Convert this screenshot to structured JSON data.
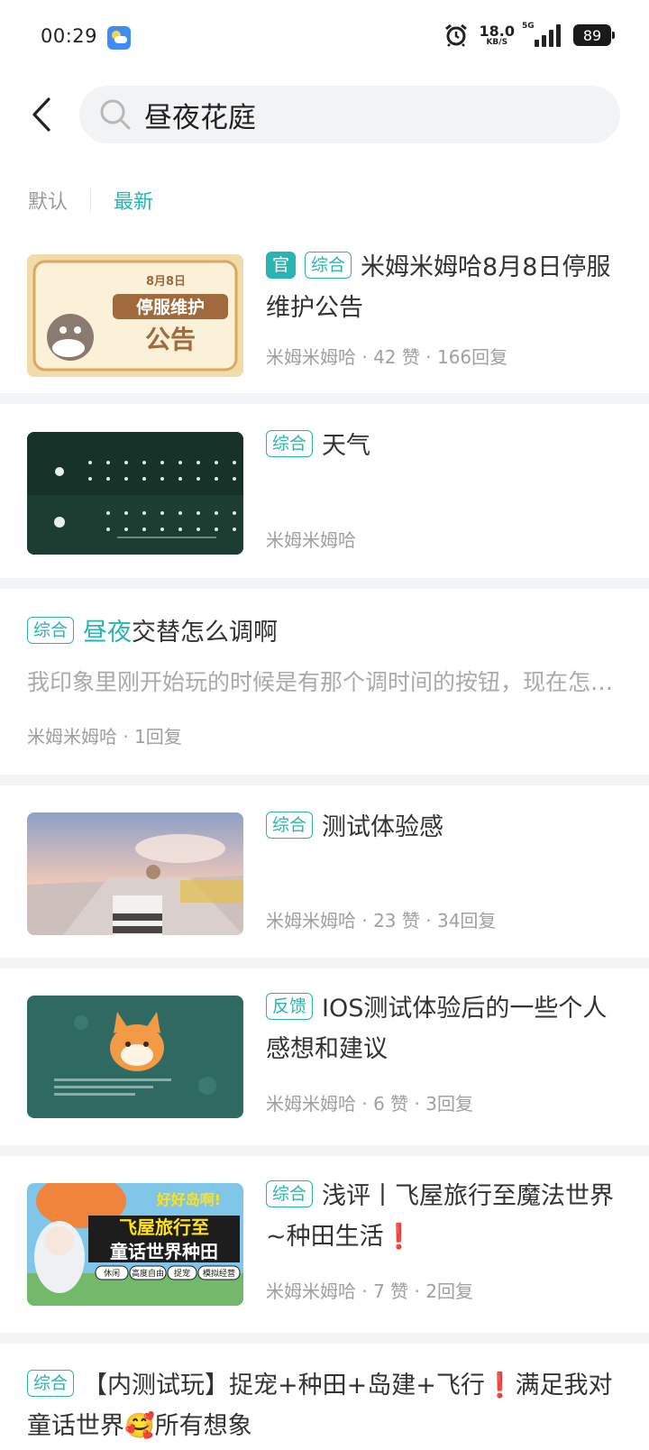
{
  "status_bar": {
    "time": "00:29",
    "net_speed": "18.0",
    "net_unit": "KB/S",
    "network_type": "5G",
    "battery": "89"
  },
  "search": {
    "query": "昼夜花庭"
  },
  "sort_tabs": {
    "default_label": "默认",
    "latest_label": "最新",
    "active": "latest"
  },
  "colors": {
    "accent": "#2ab3b3",
    "alert": "#e23b3b"
  },
  "posts": [
    {
      "tags": [
        "官",
        "综合"
      ],
      "title": "米姆米姆哈8月8日停服维护公告",
      "author": "米姆米姆哈",
      "likes": "42 赞",
      "replies": "166回复",
      "thumb_text_1": "8月8日",
      "thumb_text_2": "停服维护",
      "thumb_text_3": "公告"
    },
    {
      "tags": [
        "综合"
      ],
      "title": "天气",
      "author": "米姆米姆哈"
    },
    {
      "tags": [
        "综合"
      ],
      "title_highlight": "昼夜",
      "title_rest": "交替怎么调啊",
      "excerpt": "我印象里刚开始玩的时候是有那个调时间的按钮，现在怎么找不到了呢",
      "author": "米姆米姆哈",
      "replies": "1回复"
    },
    {
      "tags": [
        "综合"
      ],
      "title": "测试体验感",
      "author": "米姆米姆哈",
      "likes": "23 赞",
      "replies": "34回复"
    },
    {
      "tags": [
        "反馈"
      ],
      "title": "IOS测试体验后的一些个人感想和建议",
      "author": "米姆米姆哈",
      "likes": "6 赞",
      "replies": "3回复"
    },
    {
      "tags": [
        "综合"
      ],
      "title": "浅评丨飞屋旅行至魔法世界~种田生活",
      "title_mark": "❗",
      "author": "米姆米姆哈",
      "likes": "7 赞",
      "replies": "2回复",
      "thumb_text_1": "好好岛啊!",
      "thumb_text_2": "飞屋旅行至",
      "thumb_text_3": "童话世界种田",
      "thumb_chips": [
        "休闲",
        "高度自由",
        "捉宠",
        "模拟经营"
      ]
    },
    {
      "tags": [
        "综合"
      ],
      "title_part1": "【内测试玩】捉宠+种田+岛建+飞行",
      "title_mark": "❗",
      "title_part2": "满足我对童话世界",
      "title_emoji": "🥰",
      "title_part3": "所有想象"
    }
  ]
}
